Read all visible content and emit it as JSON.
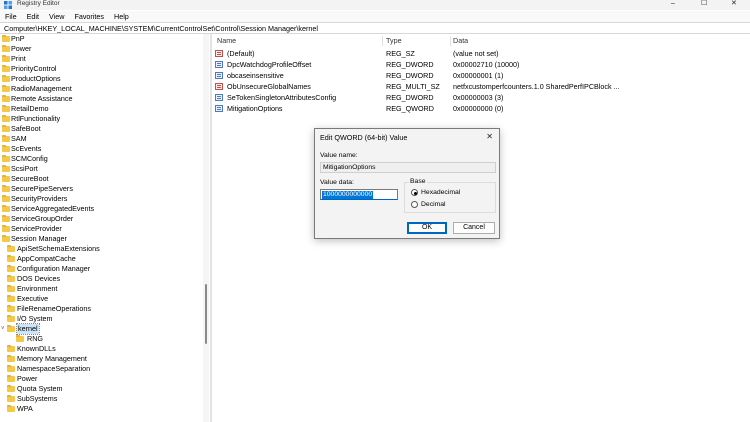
{
  "window": {
    "title": "Registry Editor",
    "minimize": "–",
    "maximize": "☐",
    "close": "✕"
  },
  "menu": [
    "File",
    "Edit",
    "View",
    "Favorites",
    "Help"
  ],
  "address": "Computer\\HKEY_LOCAL_MACHINE\\SYSTEM\\CurrentControlSet\\Control\\Session Manager\\kernel",
  "tree": {
    "items": [
      {
        "label": "PnP"
      },
      {
        "label": "Power"
      },
      {
        "label": "Print"
      },
      {
        "label": "PriorityControl"
      },
      {
        "label": "ProductOptions"
      },
      {
        "label": "RadioManagement"
      },
      {
        "label": "Remote Assistance"
      },
      {
        "label": "RetailDemo"
      },
      {
        "label": "RtlFunctionality"
      },
      {
        "label": "SafeBoot"
      },
      {
        "label": "SAM"
      },
      {
        "label": "ScEvents"
      },
      {
        "label": "SCMConfig"
      },
      {
        "label": "ScsiPort"
      },
      {
        "label": "SecureBoot"
      },
      {
        "label": "SecurePipeServers"
      },
      {
        "label": "SecurityProviders"
      },
      {
        "label": "ServiceAggregatedEvents"
      },
      {
        "label": "ServiceGroupOrder"
      },
      {
        "label": "ServiceProvider"
      },
      {
        "label": "Session Manager"
      },
      {
        "label": "ApiSetSchemaExtensions"
      },
      {
        "label": "AppCompatCache"
      },
      {
        "label": "Configuration Manager"
      },
      {
        "label": "DOS Devices"
      },
      {
        "label": "Environment"
      },
      {
        "label": "Executive"
      },
      {
        "label": "FileRenameOperations"
      },
      {
        "label": "I/O System"
      },
      {
        "label": "kernel"
      },
      {
        "label": "RNG"
      },
      {
        "label": "KnownDLLs"
      },
      {
        "label": "Memory Management"
      },
      {
        "label": "NamespaceSeparation"
      },
      {
        "label": "Power"
      },
      {
        "label": "Quota System"
      },
      {
        "label": "SubSystems"
      },
      {
        "label": "WPA"
      }
    ],
    "expanded_glyph": "˅"
  },
  "list": {
    "columns": [
      "Name",
      "Type",
      "Data"
    ],
    "rows": [
      {
        "name": "(Default)",
        "type": "REG_SZ",
        "data": "(value not set)",
        "icon": "string-value-icon"
      },
      {
        "name": "DpcWatchdogProfileOffset",
        "type": "REG_DWORD",
        "data": "0x00002710 (10000)",
        "icon": "binary-value-icon"
      },
      {
        "name": "obcaseinsensitive",
        "type": "REG_DWORD",
        "data": "0x00000001 (1)",
        "icon": "binary-value-icon"
      },
      {
        "name": "ObUnsecureGlobalNames",
        "type": "REG_MULTI_SZ",
        "data": "netfxcustomperfcounters.1.0 SharedPerfIPCBlock ...",
        "icon": "string-value-icon"
      },
      {
        "name": "SeTokenSingletonAttributesConfig",
        "type": "REG_DWORD",
        "data": "0x00000003 (3)",
        "icon": "binary-value-icon"
      },
      {
        "name": "MitigationOptions",
        "type": "REG_QWORD",
        "data": "0x00000000 (0)",
        "icon": "binary-value-icon"
      }
    ]
  },
  "dialog": {
    "title": "Edit QWORD (64-bit) Value",
    "close": "✕",
    "value_name_label": "Value name:",
    "value_name": "MitigationOptions",
    "value_data_label": "Value data:",
    "value_data": "1000000000000",
    "base_label": "Base",
    "hex_label": "Hexadecimal",
    "dec_label": "Decimal",
    "selected_base": "Hexadecimal",
    "ok": "OK",
    "cancel": "Cancel"
  }
}
